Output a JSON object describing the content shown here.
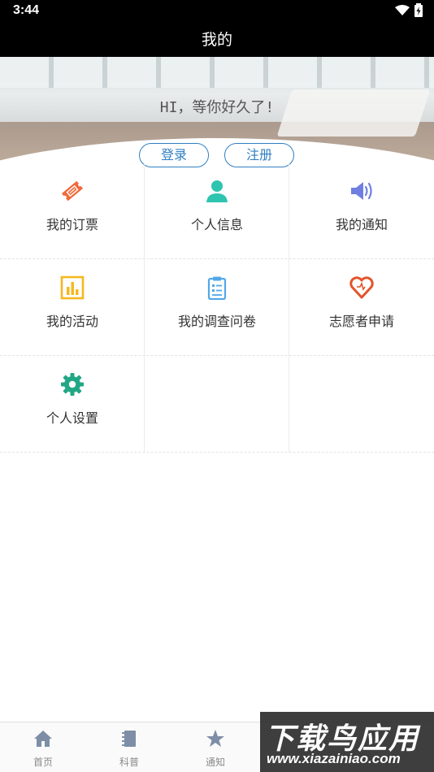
{
  "status_bar": {
    "time": "3:44",
    "wifi_icon": "wifi-icon",
    "battery_icon": "battery-icon"
  },
  "header": {
    "title": "我的"
  },
  "hero": {
    "greeting": "HI，等你好久了!",
    "login_label": "登录",
    "register_label": "注册"
  },
  "menu": [
    {
      "id": "tickets",
      "label": "我的订票",
      "icon": "ticket-icon",
      "color": "#f06a3a"
    },
    {
      "id": "profile",
      "label": "个人信息",
      "icon": "user-icon",
      "color": "#2ec4b0"
    },
    {
      "id": "notices",
      "label": "我的通知",
      "icon": "speaker-icon",
      "color": "#6f7fe0"
    },
    {
      "id": "activities",
      "label": "我的活动",
      "icon": "bar-chart-icon",
      "color": "#f5b820"
    },
    {
      "id": "surveys",
      "label": "我的调查问卷",
      "icon": "clipboard-icon",
      "color": "#52a8e8"
    },
    {
      "id": "volunteer",
      "label": "志愿者申请",
      "icon": "heart-icon",
      "color": "#e2542a"
    },
    {
      "id": "settings",
      "label": "个人设置",
      "icon": "gear-icon",
      "color": "#22a786"
    }
  ],
  "bottom_nav": [
    {
      "label": "首页",
      "icon": "home-icon"
    },
    {
      "label": "科普",
      "icon": "notebook-icon"
    },
    {
      "label": "通知",
      "icon": "star-icon"
    }
  ],
  "watermark": {
    "title": "下载鸟应用",
    "url": "www.xiazainiao.com"
  },
  "colors": {
    "accent": "#2f7fc1",
    "header_bg": "#000000",
    "nav_label": "#8a8a8a"
  }
}
